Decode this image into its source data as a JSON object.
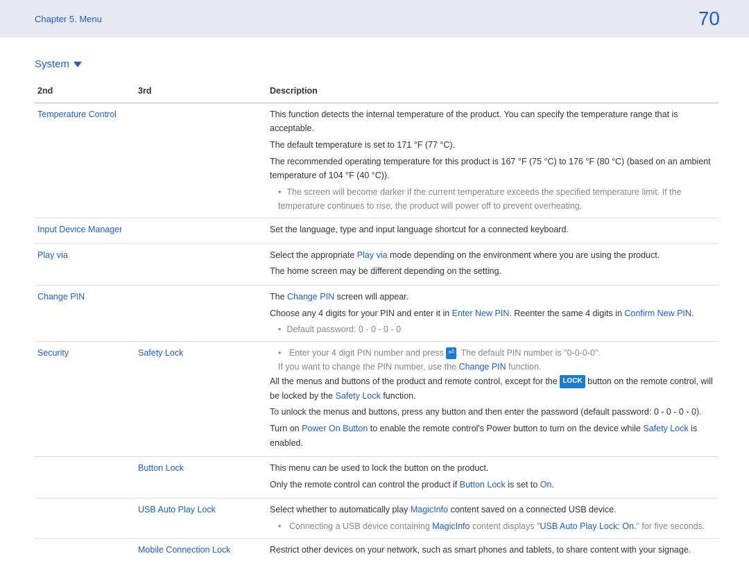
{
  "header": {
    "breadcrumb": "Chapter 5. Menu",
    "page": "70"
  },
  "section": {
    "title": "System"
  },
  "table": {
    "head": {
      "c1": "2nd",
      "c2": "3rd",
      "c3": "Description"
    }
  },
  "rows": {
    "temp": {
      "label": "Temperature Control",
      "p1": "This function detects the internal temperature of the product. You can specify the temperature range that is acceptable.",
      "p2": "The default temperature is set to 171 °F (77 °C).",
      "p3": "The recommended operating temperature for this product is 167 °F (75 °C) to 176 °F (80 °C) (based on an ambient temperature of 104 °F (40 °C)).",
      "b1": "The screen will become darker if the current temperature exceeds the specified temperature limit. If the temperature continues to rise, the product will power off to prevent overheating."
    },
    "input": {
      "label": "Input Device Manager",
      "p1": "Set the language, type and input language shortcut for a connected keyboard."
    },
    "play": {
      "label": "Play via",
      "p1a": "Select the appropriate ",
      "p1b": "Play via",
      "p1c": " mode depending on the environment where you are using the product.",
      "p2": "The home screen may be different depending on the setting."
    },
    "pin": {
      "label": "Change PIN",
      "p1a": "The ",
      "p1b": "Change PIN",
      "p1c": " screen will appear.",
      "p2a": "Choose any 4 digits for your PIN and enter it in ",
      "p2b": "Enter New PIN",
      "p2c": ". Reenter the same 4 digits in ",
      "p2d": "Confirm New PIN",
      "p2e": ".",
      "b1": "Default password: 0 - 0 - 0 - 0"
    },
    "security": {
      "label": "Security"
    },
    "safety": {
      "label": "Safety Lock",
      "b1a": "Enter your 4 digit PIN number and press ",
      "b1b": ". The default PIN number is \"0-0-0-0\".",
      "b1c": "If you want to change the PIN number, use the ",
      "b1d": "Change PIN",
      "b1e": " function.",
      "p1a": "All the menus and buttons of the product and remote control, except for the ",
      "lock": "LOCK",
      "p1b": " button on the remote control, will be locked by the ",
      "p1c": "Safety Lock",
      "p1d": " function.",
      "p2": "To unlock the menus and buttons, press any button and then enter the password (default password: 0 - 0 - 0 - 0).",
      "p3a": "Turn on ",
      "p3b": "Power On Button",
      "p3c": " to enable the remote control's Power button to turn on the device while ",
      "p3d": "Safety Lock",
      "p3e": " is enabled."
    },
    "button": {
      "label": "Button Lock",
      "p1": "This menu can be used to lock the button on the product.",
      "p2a": "Only the remote control can control the product if ",
      "p2b": "Button Lock",
      "p2c": " is set to ",
      "p2d": "On",
      "p2e": "."
    },
    "usb": {
      "label": "USB Auto Play Lock",
      "p1a": "Select whether to automatically play ",
      "p1b": "MagicInfo",
      "p1c": " content saved on a connected USB device.",
      "b1a": "Connecting a USB device containing ",
      "b1b": "MagicInfo",
      "b1c": " content displays \"",
      "b1d": "USB Auto Play Lock: On.",
      "b1e": "\" for five seconds."
    },
    "mobile": {
      "label": "Mobile Connection Lock",
      "p1": "Restrict other devices on your network, such as smart phones and tablets, to share content with your signage."
    }
  }
}
